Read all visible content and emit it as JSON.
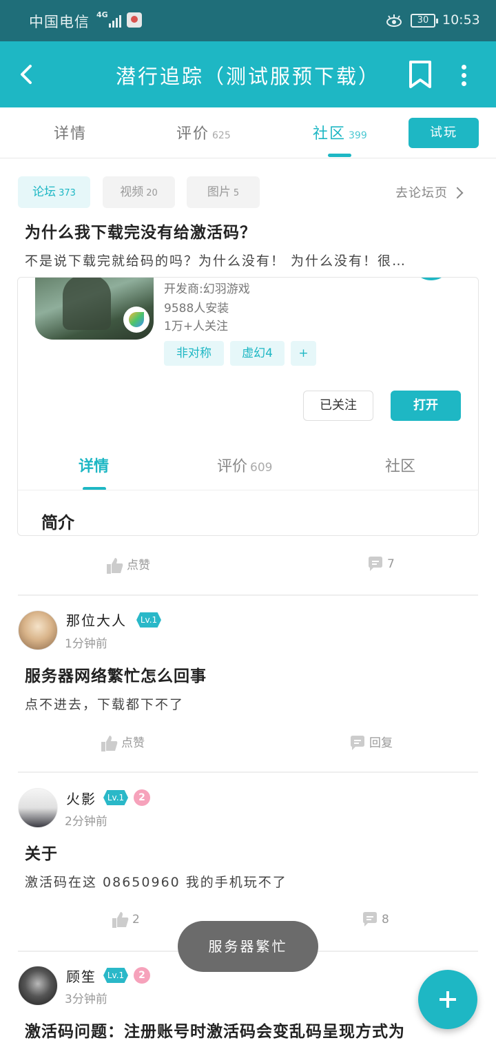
{
  "status_bar": {
    "carrier": "中国电信",
    "network": "4G",
    "battery": "30",
    "time": "10:53"
  },
  "app_bar": {
    "title": "潜行追踪（测试服预下载）"
  },
  "tabs": [
    {
      "label": "详情",
      "count": ""
    },
    {
      "label": "评价",
      "count": "625"
    },
    {
      "label": "社区",
      "count": "399"
    }
  ],
  "trial_button": "试玩",
  "filters": [
    {
      "label": "论坛",
      "count": "373"
    },
    {
      "label": "视频",
      "count": "20"
    },
    {
      "label": "图片",
      "count": "5"
    }
  ],
  "goto_forum": "去论坛页",
  "posts": [
    {
      "title": "为什么我下载完没有给激活码？",
      "text": "不是说下载完就给码的吗？为什么没有！ 为什么没有！很…",
      "embed": {
        "developer": "开发商:幻羽游戏",
        "installs": "9588人安装",
        "followers": "1万+人关注",
        "tags": [
          "非对称",
          "虚幻4",
          "+"
        ],
        "followed_label": "已关注",
        "open_label": "打开",
        "inner_tabs": [
          {
            "label": "详情",
            "count": ""
          },
          {
            "label": "评价",
            "count": "609"
          },
          {
            "label": "社区",
            "count": ""
          }
        ],
        "intro_heading": "简介"
      },
      "like_label": "点赞",
      "comment_label": "7"
    },
    {
      "user": "那位大人",
      "level": "Lv.1",
      "time": "1分钟前",
      "title": "服务器网络繁忙怎么回事",
      "text": "点不进去，下载都下不了",
      "like_label": "点赞",
      "comment_label": "回复"
    },
    {
      "user": "火影",
      "level": "Lv.1",
      "medal": "2",
      "time": "2分钟前",
      "title": "关于",
      "text": "激活码在这 08650960 我的手机玩不了",
      "like_label": "2",
      "comment_label": "8"
    },
    {
      "user": "顾笙",
      "level": "Lv.1",
      "medal": "2",
      "time": "3分钟前",
      "title": "激活码问题：注册账号时激活码会变乱码呈现方式为"
    }
  ],
  "toast": "服务器繁忙",
  "colors": {
    "accent": "#1eb7c4",
    "status_bar": "#1f6e79"
  }
}
